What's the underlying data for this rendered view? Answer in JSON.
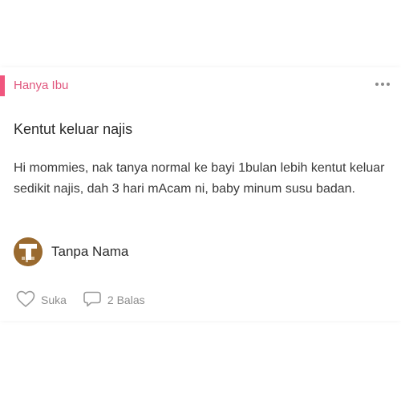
{
  "colors": {
    "accent": "#f0567e",
    "category_text": "#e0567d",
    "icon_gray": "#9a9a9a",
    "avatar_bg": "#9a6a2f"
  },
  "post": {
    "category": "Hanya Ibu",
    "more_icon": "more-horizontal-icon",
    "title": "Kentut keluar najis",
    "body": "Hi mommies, nak tanya normal ke bayi 1bulan lebih kentut keluar sedikit najis, dah 3 hari mAcam ni, baby minum susu badan.",
    "author": {
      "name": "Tanpa Nama",
      "avatar_icon": "anonymous-avatar-icon"
    },
    "actions": {
      "like_label": "Suka",
      "like_icon": "heart-outline-icon",
      "reply_label": "2 Balas",
      "reply_icon": "speech-bubble-icon"
    }
  }
}
